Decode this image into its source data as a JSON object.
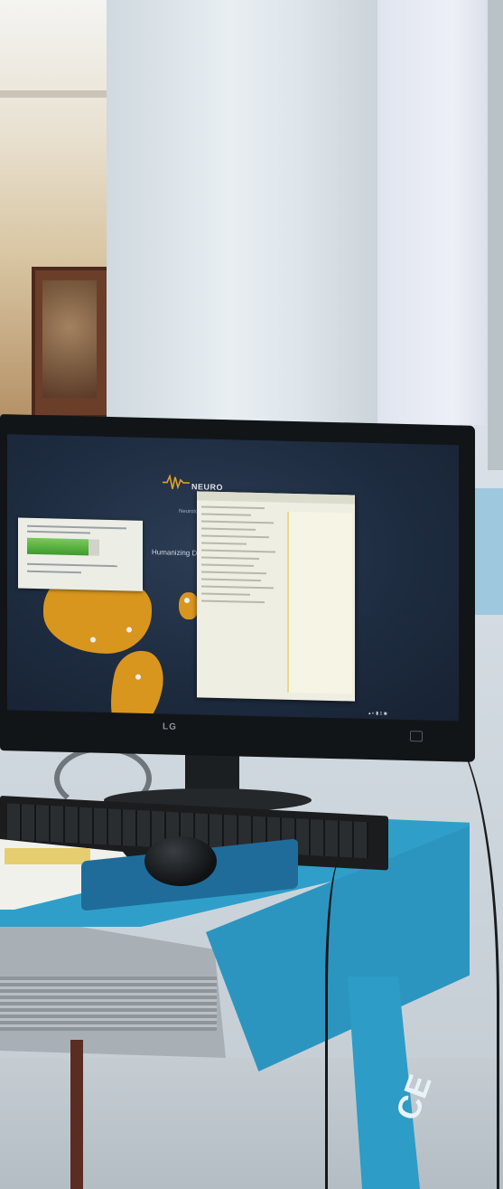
{
  "scene": {
    "description_colors": {
      "desk_blue": "#2f9fc9",
      "map_orange": "#d9961e",
      "screen_navy": "#1e2c40"
    }
  },
  "monitor": {
    "brand": "LG",
    "screen": {
      "app_logo_text": "NEURO",
      "subtitle": "Neurotoxicology",
      "heading": "Humanizing Diagnosis",
      "dialog_progress_fraction": 0.85
    }
  }
}
